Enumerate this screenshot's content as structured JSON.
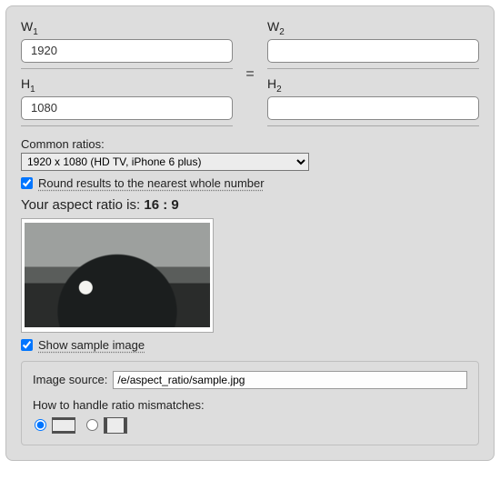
{
  "fields": {
    "w1_label": "W",
    "w1_sub": "1",
    "w1_value": "1920",
    "h1_label": "H",
    "h1_sub": "1",
    "h1_value": "1080",
    "w2_label": "W",
    "w2_sub": "2",
    "w2_value": "",
    "h2_label": "H",
    "h2_sub": "2",
    "h2_value": "",
    "equals": "="
  },
  "common_ratios": {
    "label": "Common ratios:",
    "selected": "1920 x 1080 (HD TV, iPhone 6 plus)"
  },
  "round": {
    "checked": true,
    "label": "Round results to the nearest whole number"
  },
  "result": {
    "prefix": "Your aspect ratio is: ",
    "value": "16 : 9"
  },
  "show_sample": {
    "checked": true,
    "label": "Show sample image"
  },
  "image_source": {
    "label": "Image source:",
    "value": "/e/aspect_ratio/sample.jpg"
  },
  "mismatch": {
    "label": "How to handle ratio mismatches:",
    "selected": 0
  }
}
